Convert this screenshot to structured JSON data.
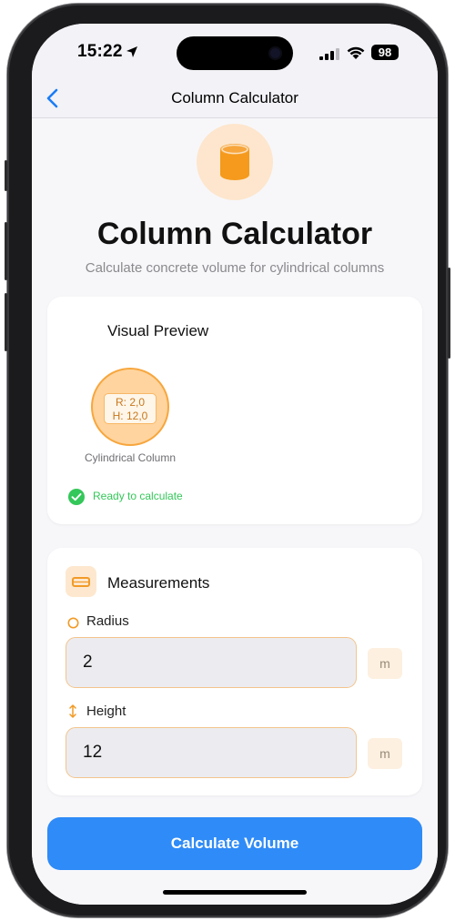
{
  "status_bar": {
    "time": "15:22",
    "battery": "98"
  },
  "nav": {
    "title": "Column Calculator",
    "back_icon": "chevron-left-icon"
  },
  "hero": {
    "icon": "cylinder-icon",
    "title": "Column Calculator",
    "subtitle": "Calculate concrete volume for cylindrical columns"
  },
  "preview": {
    "title": "Visual Preview",
    "radius_label": "R: 2,0",
    "height_label": "H: 12,0",
    "caption": "Cylindrical Column",
    "status": "Ready to calculate"
  },
  "measurements": {
    "title": "Measurements",
    "fields": [
      {
        "label": "Radius",
        "value": "2",
        "unit": "m"
      },
      {
        "label": "Height",
        "value": "12",
        "unit": "m"
      }
    ]
  },
  "actions": {
    "calculate_label": "Calculate Volume"
  },
  "colors": {
    "accent_orange": "#f7a63d",
    "button_blue": "#2f8bf7",
    "success_green": "#34c759",
    "back_blue": "#1a7cf6"
  }
}
